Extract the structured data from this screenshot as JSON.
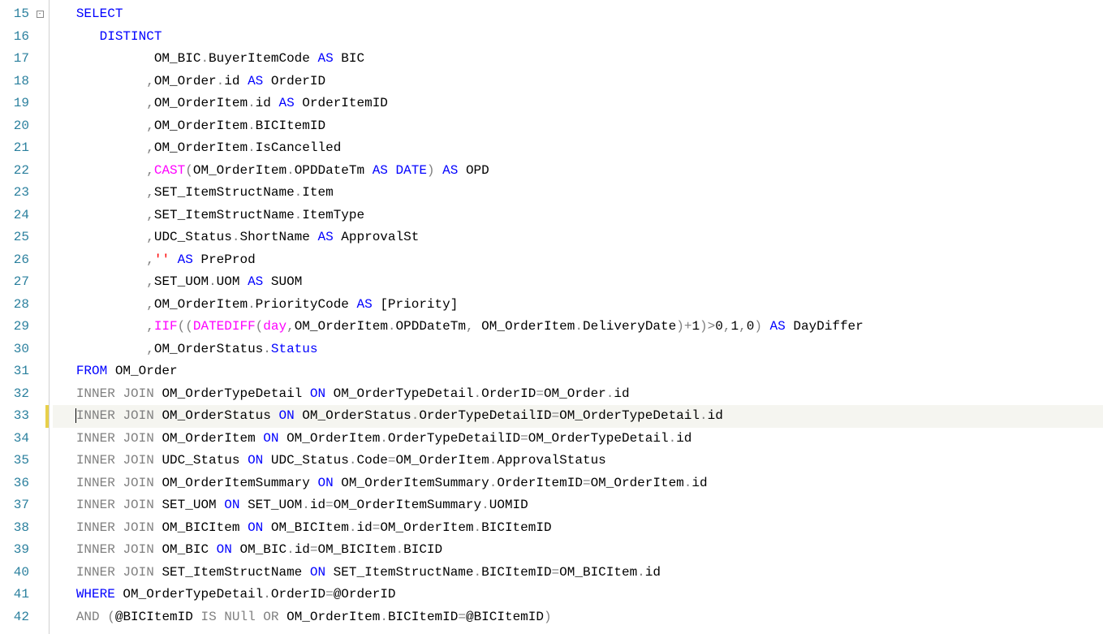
{
  "startLine": 15,
  "foldMarkLine": 15,
  "currentLine": 33,
  "modifiedLine": 33,
  "lines": [
    [
      [
        "kw-blue",
        "SELECT"
      ]
    ],
    [
      [
        "sp",
        "   "
      ],
      [
        "kw-blue",
        "DISTINCT"
      ]
    ],
    [
      [
        "sp",
        "          "
      ],
      [
        "identifier",
        "OM_BIC"
      ],
      [
        "op",
        "."
      ],
      [
        "identifier",
        "BuyerItemCode "
      ],
      [
        "kw-blue",
        "AS"
      ],
      [
        "identifier",
        " BIC"
      ]
    ],
    [
      [
        "sp",
        "         "
      ],
      [
        "punct",
        ","
      ],
      [
        "identifier",
        "OM_Order"
      ],
      [
        "op",
        "."
      ],
      [
        "identifier",
        "id "
      ],
      [
        "kw-blue",
        "AS"
      ],
      [
        "identifier",
        " OrderID"
      ]
    ],
    [
      [
        "sp",
        "         "
      ],
      [
        "punct",
        ","
      ],
      [
        "identifier",
        "OM_OrderItem"
      ],
      [
        "op",
        "."
      ],
      [
        "identifier",
        "id "
      ],
      [
        "kw-blue",
        "AS"
      ],
      [
        "identifier",
        " OrderItemID"
      ]
    ],
    [
      [
        "sp",
        "         "
      ],
      [
        "punct",
        ","
      ],
      [
        "identifier",
        "OM_OrderItem"
      ],
      [
        "op",
        "."
      ],
      [
        "identifier",
        "BICItemID"
      ]
    ],
    [
      [
        "sp",
        "         "
      ],
      [
        "punct",
        ","
      ],
      [
        "identifier",
        "OM_OrderItem"
      ],
      [
        "op",
        "."
      ],
      [
        "identifier",
        "IsCancelled"
      ]
    ],
    [
      [
        "sp",
        "         "
      ],
      [
        "punct",
        ","
      ],
      [
        "kw-pink",
        "CAST"
      ],
      [
        "paren",
        "("
      ],
      [
        "identifier",
        "OM_OrderItem"
      ],
      [
        "op",
        "."
      ],
      [
        "identifier",
        "OPDDateTm "
      ],
      [
        "kw-blue",
        "AS"
      ],
      [
        "identifier",
        " "
      ],
      [
        "kw-blue",
        "DATE"
      ],
      [
        "paren",
        ")"
      ],
      [
        "identifier",
        " "
      ],
      [
        "kw-blue",
        "AS"
      ],
      [
        "identifier",
        " OPD"
      ]
    ],
    [
      [
        "sp",
        "         "
      ],
      [
        "punct",
        ","
      ],
      [
        "identifier",
        "SET_ItemStructName"
      ],
      [
        "op",
        "."
      ],
      [
        "identifier",
        "Item"
      ]
    ],
    [
      [
        "sp",
        "         "
      ],
      [
        "punct",
        ","
      ],
      [
        "identifier",
        "SET_ItemStructName"
      ],
      [
        "op",
        "."
      ],
      [
        "identifier",
        "ItemType"
      ]
    ],
    [
      [
        "sp",
        "         "
      ],
      [
        "punct",
        ","
      ],
      [
        "identifier",
        "UDC_Status"
      ],
      [
        "op",
        "."
      ],
      [
        "identifier",
        "ShortName "
      ],
      [
        "kw-blue",
        "AS"
      ],
      [
        "identifier",
        " ApprovalSt"
      ]
    ],
    [
      [
        "sp",
        "         "
      ],
      [
        "punct",
        ","
      ],
      [
        "str-red",
        "''"
      ],
      [
        "identifier",
        " "
      ],
      [
        "kw-blue",
        "AS"
      ],
      [
        "identifier",
        " PreProd"
      ]
    ],
    [
      [
        "sp",
        "         "
      ],
      [
        "punct",
        ","
      ],
      [
        "identifier",
        "SET_UOM"
      ],
      [
        "op",
        "."
      ],
      [
        "identifier",
        "UOM "
      ],
      [
        "kw-blue",
        "AS"
      ],
      [
        "identifier",
        " SUOM"
      ]
    ],
    [
      [
        "sp",
        "         "
      ],
      [
        "punct",
        ","
      ],
      [
        "identifier",
        "OM_OrderItem"
      ],
      [
        "op",
        "."
      ],
      [
        "identifier",
        "PriorityCode "
      ],
      [
        "kw-blue",
        "AS"
      ],
      [
        "identifier",
        " "
      ],
      [
        "identifier",
        "[Priority]"
      ]
    ],
    [
      [
        "sp",
        "         "
      ],
      [
        "punct",
        ","
      ],
      [
        "kw-pink",
        "IIF"
      ],
      [
        "paren",
        "(("
      ],
      [
        "kw-pink",
        "DATEDIFF"
      ],
      [
        "paren",
        "("
      ],
      [
        "kw-pink",
        "day"
      ],
      [
        "punct",
        ","
      ],
      [
        "identifier",
        "OM_OrderItem"
      ],
      [
        "op",
        "."
      ],
      [
        "identifier",
        "OPDDateTm"
      ],
      [
        "punct",
        ","
      ],
      [
        "identifier",
        " OM_OrderItem"
      ],
      [
        "op",
        "."
      ],
      [
        "identifier",
        "DeliveryDate"
      ],
      [
        "paren",
        ")"
      ],
      [
        "op",
        "+"
      ],
      [
        "num",
        "1"
      ],
      [
        "paren",
        ")"
      ],
      [
        "op",
        ">"
      ],
      [
        "num",
        "0"
      ],
      [
        "punct",
        ","
      ],
      [
        "num",
        "1"
      ],
      [
        "punct",
        ","
      ],
      [
        "num",
        "0"
      ],
      [
        "paren",
        ")"
      ],
      [
        "identifier",
        " "
      ],
      [
        "kw-blue",
        "AS"
      ],
      [
        "identifier",
        " DayDiffer"
      ]
    ],
    [
      [
        "sp",
        "         "
      ],
      [
        "punct",
        ","
      ],
      [
        "identifier",
        "OM_OrderStatus"
      ],
      [
        "op",
        "."
      ],
      [
        "kw-blue",
        "Status"
      ]
    ],
    [
      [
        "kw-blue",
        "FROM"
      ],
      [
        "identifier",
        " OM_Order"
      ]
    ],
    [
      [
        "kw-gray",
        "INNER"
      ],
      [
        "identifier",
        " "
      ],
      [
        "kw-gray",
        "JOIN"
      ],
      [
        "identifier",
        " OM_OrderTypeDetail "
      ],
      [
        "kw-blue",
        "ON"
      ],
      [
        "identifier",
        " OM_OrderTypeDetail"
      ],
      [
        "op",
        "."
      ],
      [
        "identifier",
        "OrderID"
      ],
      [
        "op",
        "="
      ],
      [
        "identifier",
        "OM_Order"
      ],
      [
        "op",
        "."
      ],
      [
        "identifier",
        "id"
      ]
    ],
    [
      [
        "kw-gray",
        "INNER"
      ],
      [
        "identifier",
        " "
      ],
      [
        "kw-gray",
        "JOIN"
      ],
      [
        "identifier",
        " OM_OrderStatus "
      ],
      [
        "kw-blue",
        "ON"
      ],
      [
        "identifier",
        " OM_OrderStatus"
      ],
      [
        "op",
        "."
      ],
      [
        "identifier",
        "OrderTypeDetailID"
      ],
      [
        "op",
        "="
      ],
      [
        "identifier",
        "OM_OrderTypeDetail"
      ],
      [
        "op",
        "."
      ],
      [
        "identifier",
        "id"
      ]
    ],
    [
      [
        "kw-gray",
        "INNER"
      ],
      [
        "identifier",
        " "
      ],
      [
        "kw-gray",
        "JOIN"
      ],
      [
        "identifier",
        " OM_OrderItem "
      ],
      [
        "kw-blue",
        "ON"
      ],
      [
        "identifier",
        " OM_OrderItem"
      ],
      [
        "op",
        "."
      ],
      [
        "identifier",
        "OrderTypeDetailID"
      ],
      [
        "op",
        "="
      ],
      [
        "identifier",
        "OM_OrderTypeDetail"
      ],
      [
        "op",
        "."
      ],
      [
        "identifier",
        "id"
      ]
    ],
    [
      [
        "kw-gray",
        "INNER"
      ],
      [
        "identifier",
        " "
      ],
      [
        "kw-gray",
        "JOIN"
      ],
      [
        "identifier",
        " UDC_Status "
      ],
      [
        "kw-blue",
        "ON"
      ],
      [
        "identifier",
        " UDC_Status"
      ],
      [
        "op",
        "."
      ],
      [
        "identifier",
        "Code"
      ],
      [
        "op",
        "="
      ],
      [
        "identifier",
        "OM_OrderItem"
      ],
      [
        "op",
        "."
      ],
      [
        "identifier",
        "ApprovalStatus"
      ]
    ],
    [
      [
        "kw-gray",
        "INNER"
      ],
      [
        "identifier",
        " "
      ],
      [
        "kw-gray",
        "JOIN"
      ],
      [
        "identifier",
        " OM_OrderItemSummary "
      ],
      [
        "kw-blue",
        "ON"
      ],
      [
        "identifier",
        " OM_OrderItemSummary"
      ],
      [
        "op",
        "."
      ],
      [
        "identifier",
        "OrderItemID"
      ],
      [
        "op",
        "="
      ],
      [
        "identifier",
        "OM_OrderItem"
      ],
      [
        "op",
        "."
      ],
      [
        "identifier",
        "id"
      ]
    ],
    [
      [
        "kw-gray",
        "INNER"
      ],
      [
        "identifier",
        " "
      ],
      [
        "kw-gray",
        "JOIN"
      ],
      [
        "identifier",
        " SET_UOM "
      ],
      [
        "kw-blue",
        "ON"
      ],
      [
        "identifier",
        " SET_UOM"
      ],
      [
        "op",
        "."
      ],
      [
        "identifier",
        "id"
      ],
      [
        "op",
        "="
      ],
      [
        "identifier",
        "OM_OrderItemSummary"
      ],
      [
        "op",
        "."
      ],
      [
        "identifier",
        "UOMID"
      ]
    ],
    [
      [
        "kw-gray",
        "INNER"
      ],
      [
        "identifier",
        " "
      ],
      [
        "kw-gray",
        "JOIN"
      ],
      [
        "identifier",
        " OM_BICItem "
      ],
      [
        "kw-blue",
        "ON"
      ],
      [
        "identifier",
        " OM_BICItem"
      ],
      [
        "op",
        "."
      ],
      [
        "identifier",
        "id"
      ],
      [
        "op",
        "="
      ],
      [
        "identifier",
        "OM_OrderItem"
      ],
      [
        "op",
        "."
      ],
      [
        "identifier",
        "BICItemID"
      ]
    ],
    [
      [
        "kw-gray",
        "INNER"
      ],
      [
        "identifier",
        " "
      ],
      [
        "kw-gray",
        "JOIN"
      ],
      [
        "identifier",
        " OM_BIC "
      ],
      [
        "kw-blue",
        "ON"
      ],
      [
        "identifier",
        " OM_BIC"
      ],
      [
        "op",
        "."
      ],
      [
        "identifier",
        "id"
      ],
      [
        "op",
        "="
      ],
      [
        "identifier",
        "OM_BICItem"
      ],
      [
        "op",
        "."
      ],
      [
        "identifier",
        "BICID"
      ]
    ],
    [
      [
        "kw-gray",
        "INNER"
      ],
      [
        "identifier",
        " "
      ],
      [
        "kw-gray",
        "JOIN"
      ],
      [
        "identifier",
        " SET_ItemStructName "
      ],
      [
        "kw-blue",
        "ON"
      ],
      [
        "identifier",
        " SET_ItemStructName"
      ],
      [
        "op",
        "."
      ],
      [
        "identifier",
        "BICItemID"
      ],
      [
        "op",
        "="
      ],
      [
        "identifier",
        "OM_BICItem"
      ],
      [
        "op",
        "."
      ],
      [
        "identifier",
        "id"
      ]
    ],
    [
      [
        "kw-blue",
        "WHERE"
      ],
      [
        "identifier",
        " OM_OrderTypeDetail"
      ],
      [
        "op",
        "."
      ],
      [
        "identifier",
        "OrderID"
      ],
      [
        "op",
        "="
      ],
      [
        "identifier",
        "@OrderID"
      ]
    ],
    [
      [
        "kw-gray",
        "AND"
      ],
      [
        "identifier",
        " "
      ],
      [
        "paren",
        "("
      ],
      [
        "identifier",
        "@BICItemID "
      ],
      [
        "kw-gray",
        "IS"
      ],
      [
        "identifier",
        " "
      ],
      [
        "kw-gray",
        "NUll"
      ],
      [
        "identifier",
        " "
      ],
      [
        "kw-gray",
        "OR"
      ],
      [
        "identifier",
        " OM_OrderItem"
      ],
      [
        "op",
        "."
      ],
      [
        "identifier",
        "BICItemID"
      ],
      [
        "op",
        "="
      ],
      [
        "identifier",
        "@BICItemID"
      ],
      [
        "paren",
        ")"
      ]
    ]
  ]
}
